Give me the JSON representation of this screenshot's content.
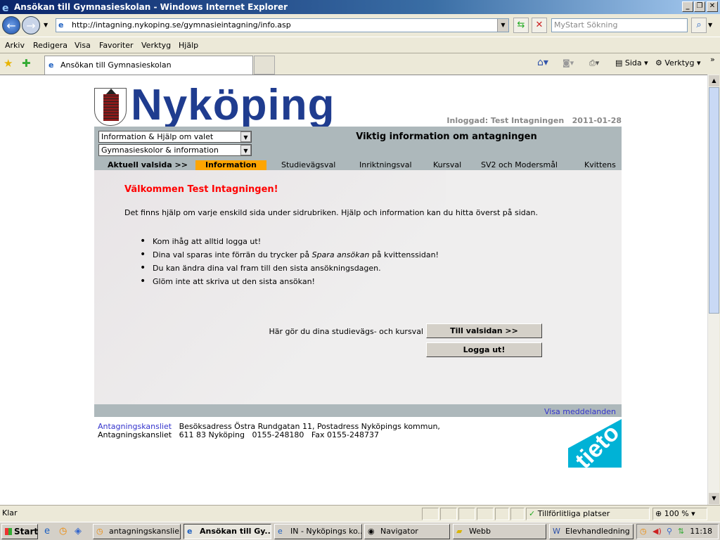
{
  "window": {
    "title": "Ansökan till Gymnasieskolan - Windows Internet Explorer"
  },
  "browser": {
    "url": "http://intagning.nykoping.se/gymnasieintagning/info.asp",
    "search_placeholder": "MyStart Sökning",
    "menu": [
      "Arkiv",
      "Redigera",
      "Visa",
      "Favoriter",
      "Verktyg",
      "Hjälp"
    ],
    "tab_title": "Ansökan till Gymnasieskolan",
    "toolbar": {
      "page": "Sida",
      "tools": "Verktyg"
    },
    "status": {
      "text": "Klar",
      "zone": "Tillförlitliga platser",
      "zoom": "100 %"
    }
  },
  "page": {
    "brand": "Nyköping",
    "logged_in": "Inloggad: Test Intagningen   2011-01-28",
    "select1": "Information & Hjälp om valet",
    "select2": "Gymnasieskolor & information",
    "heading": "Viktig information om antagningen",
    "current_label": "Aktuell valsida >>",
    "steps": [
      "Information",
      "Studievägsval",
      "Inriktningsval",
      "Kursval",
      "SV2 och Modersmål",
      "Kvittens"
    ],
    "active_step": "Information",
    "accent_color": "#ffa500",
    "welcome": "Välkommen Test Intagningen!",
    "intro": "Det finns hjälp om varje enskild sida under sidrubriken. Hjälp och information kan du hitta överst på sidan.",
    "bullets": [
      {
        "text": "Kom ihåg att alltid logga ut!"
      },
      {
        "before": "Dina val sparas inte förrän du trycker på ",
        "em": "Spara ansökan",
        "after": " på kvittenssidan!"
      },
      {
        "text": "Du kan ändra dina val fram till den sista ansökningsdagen."
      },
      {
        "text": "Glöm inte att skriva ut den sista ansökan!"
      }
    ],
    "call_label": "Här gör du dina studievägs- och kursval",
    "btn_choose": "Till valsidan >>",
    "btn_logout": "Logga ut!",
    "show_messages": "Visa meddelanden",
    "footer": {
      "link": "Antagningskansliet",
      "line1": "Besöksadress Östra Rundgatan 11, Postadress Nyköpings kommun,",
      "label2": "Antagningskansliet",
      "line2": "611 83 Nyköping   0155-248180   Fax 0155-248737"
    },
    "partner_logo": "tieto"
  },
  "taskbar": {
    "start": "Start",
    "tasks": [
      "antagningskanslie...",
      "Ansökan till Gy...",
      "IN - Nyköpings ko...",
      "Navigator",
      "Webb",
      "Elevhandledning ..."
    ],
    "clock": "11:18"
  }
}
